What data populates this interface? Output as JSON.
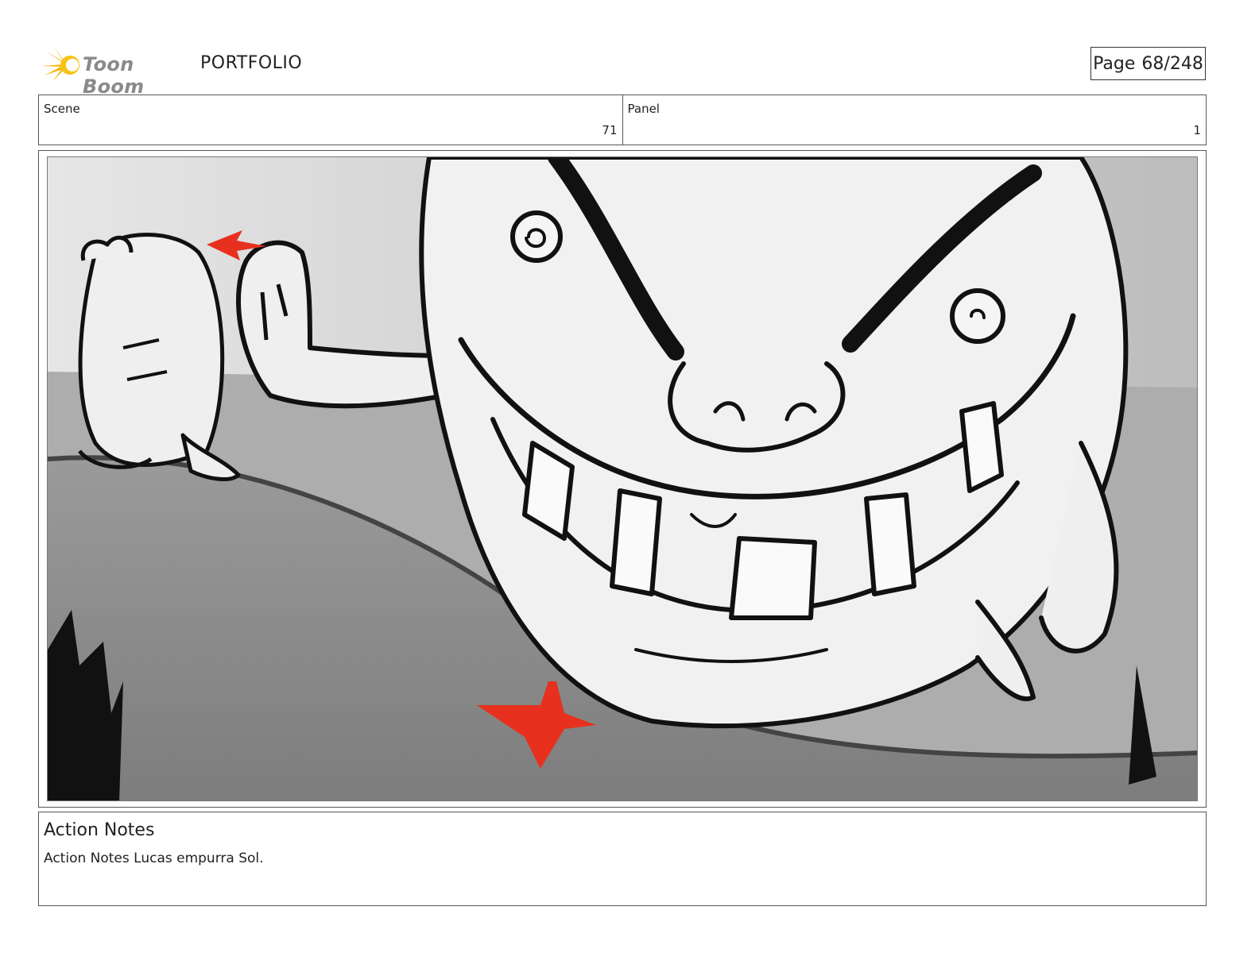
{
  "header": {
    "logo_text": "Toon Boom",
    "section_title": "PORTFOLIO",
    "page_label": "Page",
    "page_value": "68/248"
  },
  "info": {
    "scene_label": "Scene",
    "scene_value": "71",
    "panel_label": "Panel",
    "panel_value": "1"
  },
  "notes": {
    "title": "Action Notes",
    "text": "Action Notes Lucas empurra Sol."
  },
  "colors": {
    "accent_red": "#e8301e",
    "logo_yellow": "#f5b400"
  }
}
